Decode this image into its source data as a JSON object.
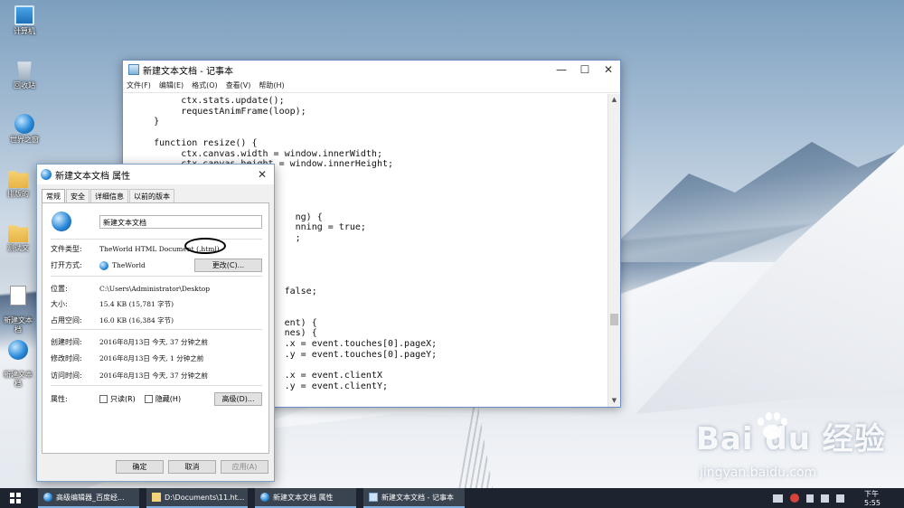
{
  "desktop": {
    "icons": [
      {
        "label": "计算机"
      },
      {
        "label": "回收站"
      },
      {
        "label": "世界之窗"
      },
      {
        "label": "排版的"
      },
      {
        "label": "测试文"
      },
      {
        "label": "新建文本\n档"
      },
      {
        "label": "新建文本\n档"
      }
    ]
  },
  "notepad": {
    "title": "新建文本文档 - 记事本",
    "menu": [
      "文件(F)",
      "编辑(E)",
      "格式(O)",
      "查看(V)",
      "帮助(H)"
    ],
    "content": "          ctx.stats.update();\n          requestAnimFrame(loop);\n     }\n\n     function resize() {\n          ctx.canvas.width = window.innerWidth;\n          ctx.canvas.height = window.innerHeight;\n     }\n\n\n\n                               ng) {\n                               nning = true;\n                               ;\n\n\n\n\n                             false;\n\n\n                             ent) {\n                             nes) {\n                             .x = event.touches[0].pageX;\n                             .y = event.touches[0].pageY;\n\n                             .x = event.clientX\n                             .y = event.clientY;"
  },
  "properties": {
    "title": "新建文本文档 属性",
    "tabs": [
      "常规",
      "安全",
      "详细信息",
      "以前的版本"
    ],
    "file_name": "新建文本文档",
    "rows": {
      "type_label": "文件类型:",
      "type_value": "TheWorld HTML Document (.html)",
      "open_label": "打开方式:",
      "open_value": "TheWorld",
      "change_btn": "更改(C)...",
      "location_label": "位置:",
      "location_value": "C:\\Users\\Administrator\\Desktop",
      "size_label": "大小:",
      "size_value": "15.4 KB (15,781 字节)",
      "disk_label": "占用空间:",
      "disk_value": "16.0 KB (16,384 字节)",
      "created_label": "创建时间:",
      "created_value": "2016年8月13日 今天, 37 分钟之前",
      "modified_label": "修改时间:",
      "modified_value": "2016年8月13日 今天, 1 分钟之前",
      "accessed_label": "访问时间:",
      "accessed_value": "2016年8月13日 今天, 37 分钟之前",
      "attr_label": "属性:",
      "readonly": "只读(R)",
      "hidden": "隐藏(H)",
      "advanced_btn": "高级(D)..."
    },
    "buttons": {
      "ok": "确定",
      "cancel": "取消",
      "apply": "应用(A)"
    }
  },
  "watermark": {
    "brand": "Bai du 经验",
    "url": "jingyan.baidu.com"
  },
  "taskbar": {
    "tasks": [
      "高级编辑器_百度经...",
      "D:\\Documents\\11.ht...",
      "新建文本文档 属性",
      "新建文本文档 - 记事本"
    ],
    "clock": "下午 5:55"
  }
}
